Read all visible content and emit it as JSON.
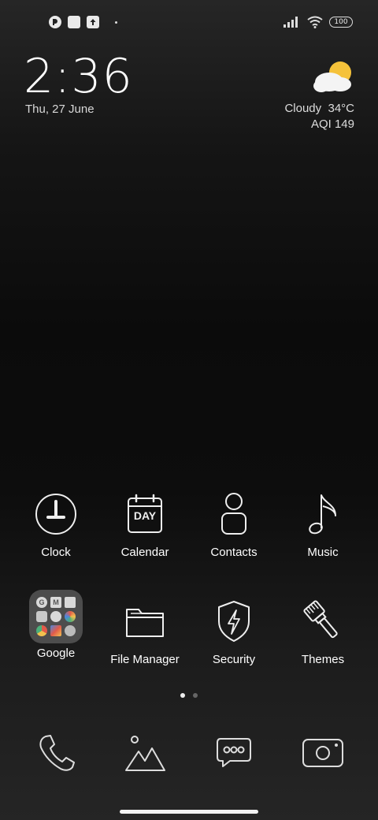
{
  "status_bar": {
    "battery_level": "100",
    "notification_icons": [
      "app-notification-icon",
      "gallery-notification-icon",
      "upload-notification-icon",
      "more-dot-icon"
    ]
  },
  "clock_widget": {
    "time": "2:36",
    "date": "Thu, 27 June"
  },
  "weather_widget": {
    "condition": "Cloudy",
    "temperature": "34°C",
    "aqi": "AQI 149"
  },
  "apps_row1": [
    {
      "label": "Clock",
      "icon": "clock-icon"
    },
    {
      "label": "Calendar",
      "icon": "calendar-icon",
      "icon_text": "DAY"
    },
    {
      "label": "Contacts",
      "icon": "contacts-icon"
    },
    {
      "label": "Music",
      "icon": "music-icon"
    }
  ],
  "apps_row2": [
    {
      "label": "Google",
      "icon": "google-folder-icon"
    },
    {
      "label": "File Manager",
      "icon": "folder-icon"
    },
    {
      "label": "Security",
      "icon": "security-shield-icon"
    },
    {
      "label": "Themes",
      "icon": "paintbrush-icon"
    }
  ],
  "pager": {
    "pages": 2,
    "current": 1
  },
  "dock": [
    "phone-icon",
    "gallery-icon",
    "messages-icon",
    "camera-icon"
  ]
}
